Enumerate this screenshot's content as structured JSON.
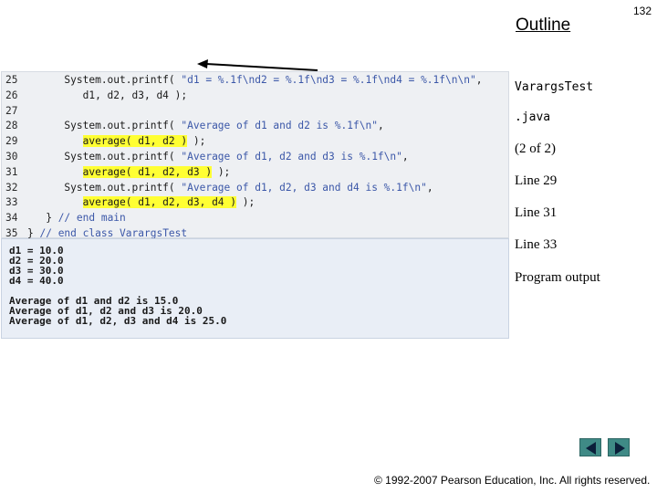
{
  "header": {
    "outline": "Outline",
    "slide_number": "132"
  },
  "code": [
    {
      "ln": "25",
      "tokens": [
        {
          "t": "      System.out.printf( ",
          "c": "plain"
        },
        {
          "t": "\"d1 = %.1f\\nd2 = %.1f\\nd3 = %.1f\\nd4 = %.1f\\n\\n\"",
          "c": "string"
        },
        {
          "t": ",",
          "c": "plain"
        }
      ]
    },
    {
      "ln": "26",
      "tokens": [
        {
          "t": "         d1, d2, d3, d4 );",
          "c": "plain"
        }
      ]
    },
    {
      "ln": "27",
      "tokens": []
    },
    {
      "ln": "28",
      "tokens": [
        {
          "t": "      System.out.printf( ",
          "c": "plain"
        },
        {
          "t": "\"Average of d1 and d2 is %.1f\\n\"",
          "c": "string"
        },
        {
          "t": ",",
          "c": "plain"
        }
      ]
    },
    {
      "ln": "29",
      "tokens": [
        {
          "t": "         ",
          "c": "plain"
        },
        {
          "t": "average( d1, d2 )",
          "c": "hl"
        },
        {
          "t": " );",
          "c": "plain"
        }
      ]
    },
    {
      "ln": "30",
      "tokens": [
        {
          "t": "      System.out.printf( ",
          "c": "plain"
        },
        {
          "t": "\"Average of d1, d2 and d3 is %.1f\\n\"",
          "c": "string"
        },
        {
          "t": ",",
          "c": "plain"
        }
      ]
    },
    {
      "ln": "31",
      "tokens": [
        {
          "t": "         ",
          "c": "plain"
        },
        {
          "t": "average( d1, d2, d3 )",
          "c": "hl"
        },
        {
          "t": " );",
          "c": "plain"
        }
      ]
    },
    {
      "ln": "32",
      "tokens": [
        {
          "t": "      System.out.printf( ",
          "c": "plain"
        },
        {
          "t": "\"Average of d1, d2, d3 and d4 is %.1f\\n\"",
          "c": "string"
        },
        {
          "t": ",",
          "c": "plain"
        }
      ]
    },
    {
      "ln": "33",
      "tokens": [
        {
          "t": "         ",
          "c": "plain"
        },
        {
          "t": "average( d1, d2, d3, d4 )",
          "c": "hl"
        },
        {
          "t": " );",
          "c": "plain"
        }
      ]
    },
    {
      "ln": "34",
      "tokens": [
        {
          "t": "   } ",
          "c": "plain"
        },
        {
          "t": "// end main",
          "c": "comment"
        }
      ]
    },
    {
      "ln": "35",
      "tokens": [
        {
          "t": "} ",
          "c": "plain"
        },
        {
          "t": "// end class VarargsTest",
          "c": "comment"
        }
      ]
    }
  ],
  "output": [
    "d1 = 10.0",
    "d2 = 20.0",
    "d3 = 30.0",
    "d4 = 40.0",
    "",
    "Average of d1 and d2 is 15.0",
    "Average of d1, d2 and d3 is 20.0",
    "Average of d1, d2, d3 and d4 is 25.0"
  ],
  "sidebar": {
    "file_name_1": "VarargsTest",
    "file_name_2": ".java",
    "page": "(2 of 2)",
    "line_29": "Line 29",
    "line_31": "Line 31",
    "line_33": "Line 33",
    "program_output": "Program output"
  },
  "footer": {
    "copyright": "© 1992-2007 Pearson Education, Inc.  All rights reserved."
  },
  "nav": {
    "prev_icon": "triangle-left-icon",
    "next_icon": "triangle-right-icon"
  },
  "colors": {
    "highlight": "#ffff33",
    "string": "#3b57a8",
    "nav": "#3f8a86"
  }
}
